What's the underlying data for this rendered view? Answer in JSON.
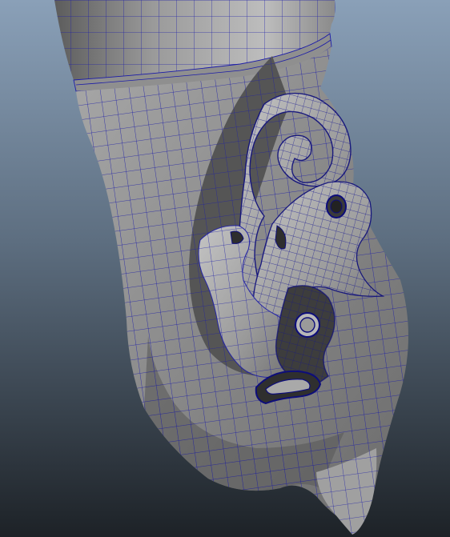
{
  "viewport": {
    "background_top": "#8a9fb7",
    "background_bottom": "#1f2429",
    "mesh_fill_light": "#b3b3b3",
    "mesh_fill_dark": "#4a4a4a",
    "wire_color": "#1c1ca8",
    "wire_dense_color": "#0d0d7a",
    "icons": [
      "wireframe-mesh-icon"
    ]
  }
}
